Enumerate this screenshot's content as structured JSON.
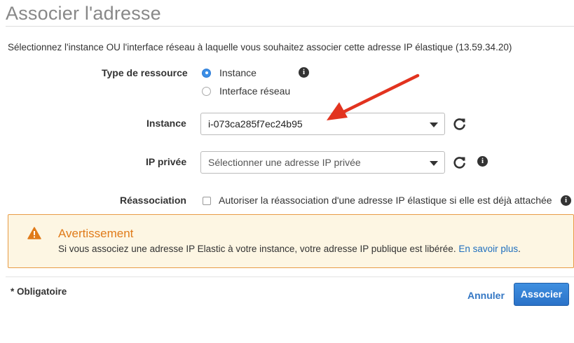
{
  "header": {
    "title": "Associer l'adresse"
  },
  "description": "Sélectionnez l'instance OU l'interface réseau à laquelle vous souhaitez associer cette adresse IP élastique (13.59.34.20)",
  "resource_type": {
    "label": "Type de ressource",
    "options": [
      {
        "label": "Instance",
        "checked": true
      },
      {
        "label": "Interface réseau",
        "checked": false
      }
    ]
  },
  "instance": {
    "label": "Instance",
    "value": "i-073ca285f7ec24b95"
  },
  "private_ip": {
    "label": "IP privée",
    "placeholder": "Sélectionner une adresse IP privée"
  },
  "reassociation": {
    "label": "Réassociation",
    "checkbox_label": "Autoriser la réassociation d'une adresse IP élastique si elle est déjà attachée",
    "checked": false
  },
  "warning": {
    "title": "Avertissement",
    "body": "Si vous associez une adresse IP Elastic à votre instance, votre adresse IP publique est libérée.",
    "link": "En savoir plus",
    "suffix": "."
  },
  "footer": {
    "required": "* Obligatoire",
    "cancel_label": "Annuler",
    "submit_label": "Associer"
  },
  "colors": {
    "accent": "#2a72c8",
    "warning": "#e07b1a",
    "annotation_arrow": "#e2331f"
  }
}
